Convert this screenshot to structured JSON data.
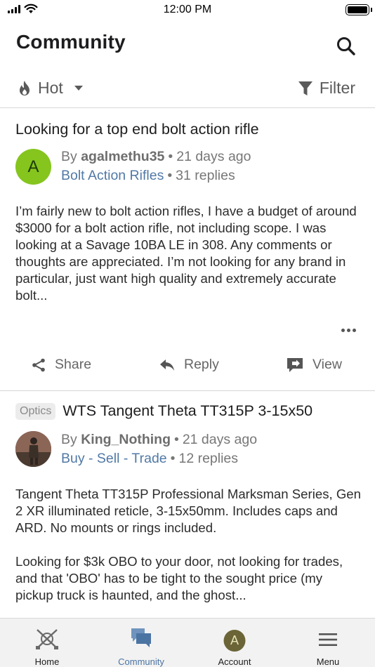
{
  "status_bar": {
    "time": "12:00 PM"
  },
  "header": {
    "title": "Community",
    "search_icon": "search-icon"
  },
  "sort": {
    "label": "Hot",
    "icon": "flame-icon"
  },
  "filter": {
    "label": "Filter",
    "icon": "funnel-icon"
  },
  "posts": [
    {
      "title": "Looking for a top end bolt action rifle",
      "avatar_letter": "A",
      "avatar_color": "#85c51e",
      "by_prefix": "By",
      "author": "agalmethu35",
      "time": "21 days ago",
      "forum": "Bolt Action Rifles",
      "replies": "31 replies",
      "body": "I’m fairly new to bolt action rifles, I have a budget of around $3000 for a bolt action rifle, not including scope. I was looking at a Savage 10BA LE in 308. Any comments or thoughts are appreciated. I’m not looking for any brand in particular, just want high quality and extremely accurate bolt...",
      "actions": {
        "share": "Share",
        "reply": "Reply",
        "view": "View"
      }
    },
    {
      "tag": "Optics",
      "title": "WTS Tangent Theta TT315P 3-15x50",
      "by_prefix": "By",
      "author": "King_Nothing",
      "time": "21 days ago",
      "forum": "Buy - Sell - Trade",
      "replies": "12 replies",
      "body_p1": "Tangent Theta TT315P Professional Marksman Series, Gen 2 XR illuminated reticle, 3-15x50mm. Includes caps and ARD. No mounts or rings included.",
      "body_p2": "Looking for $3k OBO to your door, not looking for trades, and that 'OBO' has to be tight to the sought price (my pickup truck is haunted, and the ghost..."
    }
  ],
  "tab_bar": {
    "tabs": [
      {
        "label": "Home",
        "icon": "crossed-rifles-icon"
      },
      {
        "label": "Community",
        "icon": "chat-bubbles-icon",
        "active": true
      },
      {
        "label": "Account",
        "icon": "avatar",
        "avatar_letter": "A"
      },
      {
        "label": "Menu",
        "icon": "hamburger-icon"
      }
    ]
  },
  "colors": {
    "accent": "#4b74a3",
    "forum_link": "#5179a6",
    "avatar_green": "#85c51e",
    "account_avatar": "#6b6436"
  }
}
